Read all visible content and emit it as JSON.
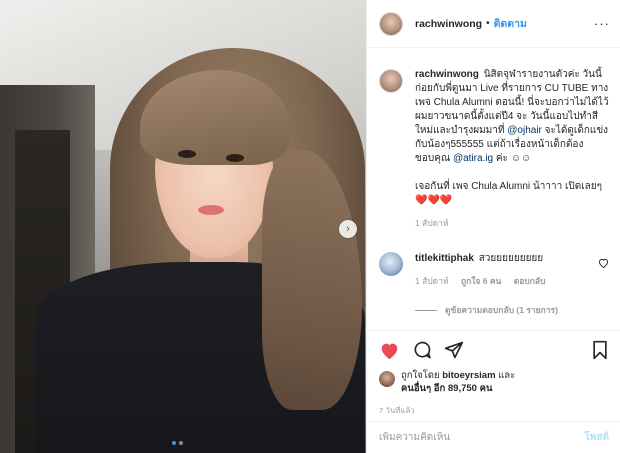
{
  "post": {
    "username": "rachwinwong",
    "follow_label": "ติดตาม",
    "more_icon": "more-icon"
  },
  "caption": {
    "username": "rachwinwong",
    "text_1": "นิสิตจุฬารายงานตัวค่ะ วันนี้ก่อยกับพี่ตูนมา Live ที่รายการ CU TUBE ทาง เพจ Chula Alumni ตอนนี้! นี่จะบอกว่าไม่ได้ไว้ผมยาวขนาดนี้ตั้งแต่ปี4 จะ วันนี้แอบไปทำสีใหม่และบำรุงผมมาที่",
    "mention_1": "@ojhair",
    "text_2": "จะได้ดูเด็กแข่งกับน้องๆ555555 แต่ถ้าเรื่องหน้าเด็กต้องขอบคุณ",
    "mention_2": "@atira.ig",
    "text_3": "ค่ะ ☺☺",
    "text_4": "เจอกันที่ เพจ Chula Alumni น้าาาา เปิดเลยๆ",
    "hearts": "❤️❤️❤️",
    "age": "1 สัปดาห์"
  },
  "comment": {
    "username": "titlekittiphak",
    "text": "สวยยยยยยยยย",
    "age": "1 สัปดาห์",
    "likes": "ถูกใจ 6 คน",
    "reply_label": "ตอบกลับ",
    "view_replies": "ดูข้อความตอบกลับ (1 รายการ)"
  },
  "likes": {
    "liked_by_prefix": "ถูกใจโดย",
    "liked_by_user": "bitoeyrsiam",
    "and": "และ",
    "others_label": "คนอื่นๆ อีก 89,750 คน"
  },
  "timestamp": "7 วันที่แล้ว",
  "add_comment": {
    "placeholder": "เพิ่มความคิดเห็น",
    "post_label": "โพสต์"
  },
  "carousel": {
    "total": 2,
    "current": 1
  },
  "colors": {
    "accent": "#3897f0",
    "like_red": "#ed4956",
    "post_disabled": "#b2dffc",
    "muted": "#999999"
  }
}
